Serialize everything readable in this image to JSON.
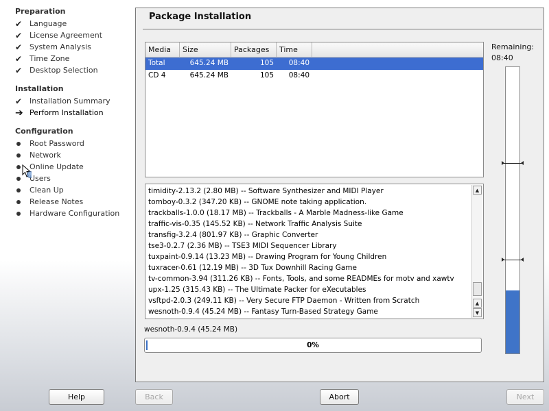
{
  "sidebar": {
    "sections": [
      {
        "title": "Preparation",
        "items": [
          {
            "label": "Language",
            "state": "done"
          },
          {
            "label": "License Agreement",
            "state": "done"
          },
          {
            "label": "System Analysis",
            "state": "done"
          },
          {
            "label": "Time Zone",
            "state": "done"
          },
          {
            "label": "Desktop Selection",
            "state": "done"
          }
        ]
      },
      {
        "title": "Installation",
        "items": [
          {
            "label": "Installation Summary",
            "state": "done"
          },
          {
            "label": "Perform Installation",
            "state": "current"
          }
        ]
      },
      {
        "title": "Configuration",
        "items": [
          {
            "label": "Root Password",
            "state": "pending"
          },
          {
            "label": "Network",
            "state": "pending"
          },
          {
            "label": "Online Update",
            "state": "pending"
          },
          {
            "label": "Users",
            "state": "pending"
          },
          {
            "label": "Clean Up",
            "state": "pending"
          },
          {
            "label": "Release Notes",
            "state": "pending"
          },
          {
            "label": "Hardware Configuration",
            "state": "pending"
          }
        ]
      }
    ]
  },
  "main": {
    "title": "Package Installation",
    "media_table": {
      "headers": [
        "Media",
        "Size",
        "Packages",
        "Time"
      ],
      "rows": [
        [
          "Total",
          "645.24 MB",
          "105",
          "08:40"
        ],
        [
          "CD 4",
          "645.24 MB",
          "105",
          "08:40"
        ]
      ]
    },
    "log_lines": [
      "timidity-2.13.2 (2.80 MB) -- Software Synthesizer and MIDI Player",
      "tomboy-0.3.2 (347.20 KB) -- GNOME note taking application.",
      "trackballs-1.0.0 (18.17 MB) -- Trackballs - A Marble Madness-like Game",
      "traffic-vis-0.35 (145.52 KB) -- Network Traffic Analysis Suite",
      "transfig-3.2.4 (801.97 KB) -- Graphic Converter",
      "tse3-0.2.7 (2.36 MB) -- TSE3 MIDI Sequencer Library",
      "tuxpaint-0.9.14 (13.23 MB) -- Drawing Program for Young Children",
      "tuxracer-0.61 (12.19 MB) -- 3D Tux Downhill Racing Game",
      "tv-common-3.94 (311.26 KB) -- Fonts, Tools, and some READMEs for motv and xawtv",
      "upx-1.25 (315.43 KB) -- The Ultimate Packer for eXecutables",
      "vsftpd-2.0.3 (249.11 KB) -- Very Secure FTP Daemon - Written from Scratch",
      "wesnoth-0.9.4 (45.24 MB) -- Fantasy Turn-Based Strategy Game"
    ],
    "current_package": "wesnoth-0.9.4 (45.24 MB)",
    "progress_text": "0%",
    "progress_value": 0,
    "remaining_label": "Remaining:",
    "remaining_time": "08:40",
    "remaining_fraction_installed": 0.22
  },
  "buttons": {
    "help": "Help",
    "back": "Back",
    "abort": "Abort",
    "next": "Next"
  },
  "colors": {
    "selection": "#3d6dd1",
    "progress_fill": "#3f74c8"
  }
}
